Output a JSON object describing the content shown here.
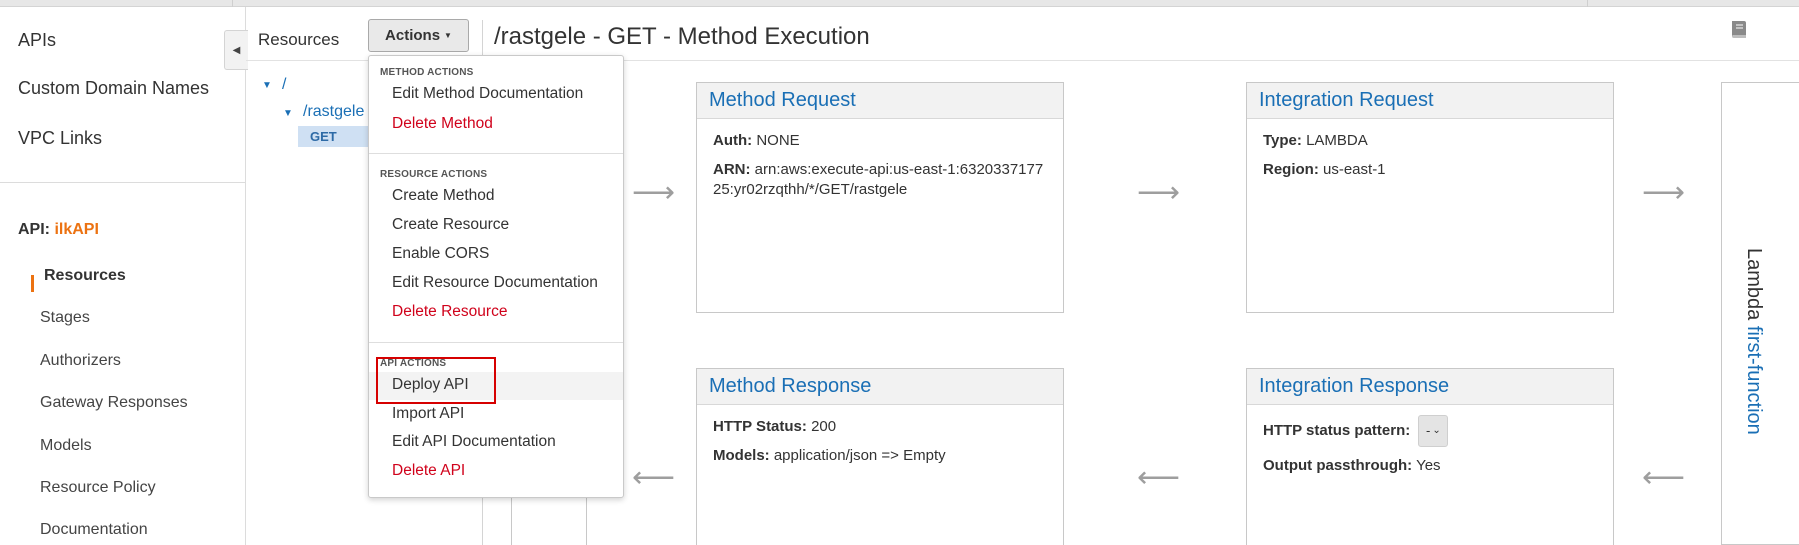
{
  "nav": {
    "top_items": [
      "APIs",
      "Custom Domain Names",
      "VPC Links"
    ],
    "api_label": "API:",
    "api_name": "ilkAPI",
    "sub_items": [
      "Resources",
      "Stages",
      "Authorizers",
      "Gateway Responses",
      "Models",
      "Resource Policy",
      "Documentation"
    ],
    "active_sub_item": "Resources"
  },
  "resources": {
    "label": "Resources",
    "actions_label": "Actions",
    "tree": [
      {
        "path": "/",
        "level": 0
      },
      {
        "path": "/rastgele",
        "level": 1
      }
    ],
    "selected_method": "GET"
  },
  "header": {
    "title": "/rastgele - GET - Method Execution",
    "book_icon": "book-icon"
  },
  "actions_menu": {
    "sections": [
      {
        "title": "METHOD ACTIONS",
        "items": [
          {
            "label": "Edit Method Documentation",
            "danger": false
          },
          {
            "label": "Delete Method",
            "danger": true
          }
        ]
      },
      {
        "title": "RESOURCE ACTIONS",
        "items": [
          {
            "label": "Create Method",
            "danger": false
          },
          {
            "label": "Create Resource",
            "danger": false
          },
          {
            "label": "Enable CORS",
            "danger": false
          },
          {
            "label": "Edit Resource Documentation",
            "danger": false
          },
          {
            "label": "Delete Resource",
            "danger": true
          }
        ]
      },
      {
        "title": "API ACTIONS",
        "items": [
          {
            "label": "Deploy API",
            "danger": false,
            "highlighted": true
          },
          {
            "label": "Import API",
            "danger": false
          },
          {
            "label": "Edit API Documentation",
            "danger": false
          },
          {
            "label": "Delete API",
            "danger": true
          }
        ]
      }
    ]
  },
  "method_request": {
    "title": "Method Request",
    "auth_key": "Auth:",
    "auth_value": "NONE",
    "arn_key": "ARN:",
    "arn_value": "arn:aws:execute-api:us-east-1:632033717725:yr02rzqthh/*/GET/rastgele"
  },
  "integration_request": {
    "title": "Integration Request",
    "type_key": "Type:",
    "type_value": "LAMBDA",
    "region_key": "Region:",
    "region_value": "us-east-1"
  },
  "method_response": {
    "title": "Method Response",
    "status_key": "HTTP Status:",
    "status_value": "200",
    "models_key": "Models:",
    "models_value": "application/json => Empty"
  },
  "integration_response": {
    "title": "Integration Response",
    "pattern_key": "HTTP status pattern:",
    "pattern_value": "-",
    "passthrough_key": "Output passthrough:",
    "passthrough_value": "Yes"
  },
  "lambda": {
    "label": "Lambda",
    "function": "first-function"
  },
  "colors": {
    "accent_orange": "#ec7211",
    "link_blue": "#1a6fb5",
    "danger_red": "#d0021b",
    "highlight_red": "#d60000"
  }
}
